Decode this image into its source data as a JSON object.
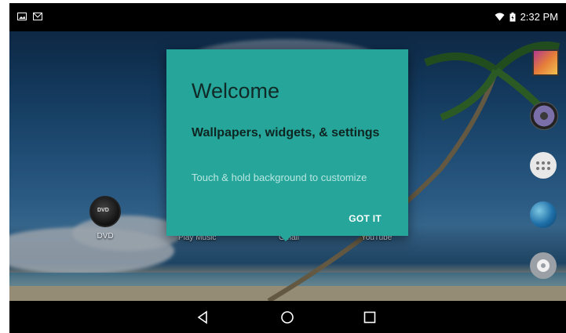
{
  "status_bar": {
    "left_icons": [
      "gallery-notification-icon",
      "gmail-notification-icon"
    ],
    "right_icons": [
      "wifi-icon",
      "battery-charging-icon"
    ],
    "time": "2:32 PM"
  },
  "home_apps": [
    {
      "label": "DVD",
      "icon": "dvd-icon"
    },
    {
      "label": "Play Music"
    },
    {
      "label": "Gmail"
    },
    {
      "label": "YouTube"
    }
  ],
  "dock": [
    {
      "icon": "gallery-icon"
    },
    {
      "icon": "music-icon"
    },
    {
      "icon": "all-apps-icon"
    },
    {
      "icon": "browser-globe-icon"
    },
    {
      "icon": "settings-icon"
    }
  ],
  "welcome_dialog": {
    "title": "Welcome",
    "subtitle": "Wallpapers, widgets, & settings",
    "body": "Touch & hold background to customize",
    "button": "GOT IT",
    "background_color": "#26a69a"
  },
  "nav_bar": {
    "buttons": [
      "back-icon",
      "home-icon",
      "recents-icon"
    ]
  }
}
